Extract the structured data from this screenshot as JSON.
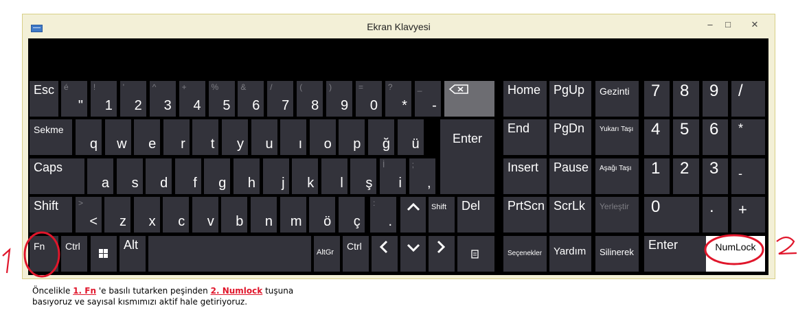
{
  "window": {
    "title": "Ekran Klavyesi",
    "minimize_glyph": "–",
    "maximize_glyph": "□",
    "close_glyph": "✕"
  },
  "rows": {
    "number_row": [
      {
        "secondary": "é",
        "main": "\""
      },
      {
        "secondary": "!",
        "main": "1"
      },
      {
        "secondary": "'",
        "main": "2"
      },
      {
        "secondary": "^",
        "main": "3"
      },
      {
        "secondary": "+",
        "main": "4"
      },
      {
        "secondary": "%",
        "main": "5"
      },
      {
        "secondary": "&",
        "main": "6"
      },
      {
        "secondary": "/",
        "main": "7"
      },
      {
        "secondary": "(",
        "main": "8"
      },
      {
        "secondary": ")",
        "main": "9"
      },
      {
        "secondary": "=",
        "main": "0"
      },
      {
        "secondary": "?",
        "main": "*"
      },
      {
        "secondary": "_",
        "main": "-"
      }
    ],
    "q_row": [
      "q",
      "w",
      "e",
      "r",
      "t",
      "y",
      "u",
      "ı",
      "o",
      "p",
      "ğ",
      "ü"
    ],
    "a_row": [
      "a",
      "s",
      "d",
      "f",
      "g",
      "h",
      "j",
      "k",
      "l",
      "ş"
    ],
    "z_row": [
      "z",
      "x",
      "c",
      "v",
      "b",
      "n",
      "m",
      "ö",
      "ç"
    ],
    "a_row_extra": [
      {
        "secondary": "İ",
        "main": "i"
      },
      {
        "secondary": ";",
        "main": ","
      }
    ],
    "z_row_extra": [
      {
        "secondary": ">",
        "main": "<"
      },
      {
        "secondary": ":",
        "main": "."
      }
    ]
  },
  "keys": {
    "esc": "Esc",
    "sekme": "Sekme",
    "caps": "Caps",
    "shift": "Shift",
    "shift_right": "Shift",
    "fn": "Fn",
    "ctrl": "Ctrl",
    "ctrl_right": "Ctrl",
    "alt": "Alt",
    "altgr": "AltGr",
    "enter": "Enter",
    "del": "Del",
    "home": "Home",
    "pgup": "PgUp",
    "gezinti": "Gezinti",
    "end": "End",
    "pgdn": "PgDn",
    "yukari": "Yukarı Taşı",
    "insert": "Insert",
    "pause": "Pause",
    "asagi": "Aşağı Taşı",
    "prtscn": "PrtScn",
    "scrlk": "ScrLk",
    "yerlestir": "Yerleştir",
    "secenekler": "Seçenekler",
    "yardim": "Yardım",
    "silinerek": "Silinerek",
    "numpad_enter": "Enter",
    "numlock": "NumLock",
    "up_arrow": "❮",
    "down_arrow": "❯"
  },
  "numpad": {
    "n7": "7",
    "n8": "8",
    "n9": "9",
    "div": "/",
    "n4": "4",
    "n5": "5",
    "n6": "6",
    "mul": "*",
    "n1": "1",
    "n2": "2",
    "n3": "3",
    "minus": "-",
    "n0": "0",
    "dot": ".",
    "plus": "+"
  },
  "annotations": {
    "one": "1",
    "two": "2"
  },
  "caption": {
    "p1": "Öncelikle ",
    "s1": "1. Fn",
    "p2": " 'e basılı tutarken peşinden ",
    "s2": "2. Numlock",
    "p3": " tuşuna",
    "line2": "basıyoruz ve sayısal kısmımızı aktif hale getiriyoruz."
  },
  "colors": {
    "key": "#33333b",
    "panel": "#000000",
    "selected": "#ffffff",
    "annotation": "#e0162b",
    "backspace": "#6d6d72"
  }
}
